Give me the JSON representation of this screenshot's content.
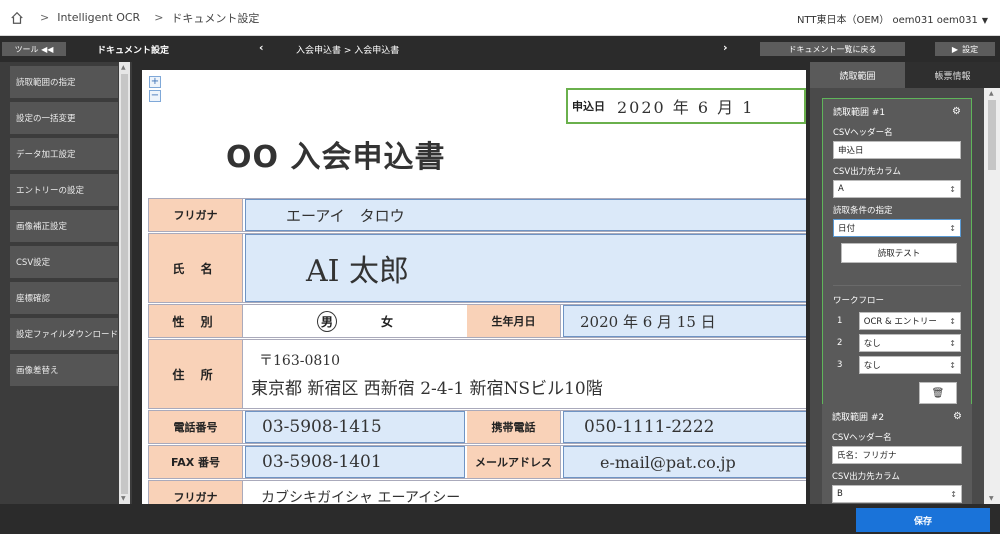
{
  "header": {
    "crumbs": [
      "Intelligent OCR",
      "ドキュメント設定"
    ],
    "separator": ">",
    "user": "NTT東日本（OEM） oem031 oem031"
  },
  "toolbar": {
    "tool_label": "ツール ◀◀",
    "doc_settings_title": "ドキュメント設定",
    "prev": "‹",
    "path": "入会申込書 > 入会申込書",
    "next": "›",
    "back_to_list": "ドキュメント一覧に戻る",
    "settings": "設定"
  },
  "sidebar": {
    "items": [
      {
        "label": "読取範囲の指定"
      },
      {
        "label": "設定の一括変更"
      },
      {
        "label": "データ加工設定"
      },
      {
        "label": "エントリーの設定"
      },
      {
        "label": "画像補正設定"
      },
      {
        "label": "CSV設定"
      },
      {
        "label": "座標確認"
      },
      {
        "label": "設定ファイルダウンロード"
      },
      {
        "label": "画像差替え"
      }
    ]
  },
  "document": {
    "apply_date_label": "申込日",
    "apply_date_value": "2020 年 6 月 1",
    "title": "OO 入会申込書",
    "rows": {
      "furigana_label": "フリガナ",
      "furigana_value": "エーアイ　タロウ",
      "name_label": "氏 名",
      "name_value": "AI 太郎",
      "gender_label": "性 別",
      "gender_male": "男",
      "gender_female": "女",
      "birth_label": "生年月日",
      "birth_value": "2020 年 6 月 15 日",
      "address_label": "住 所",
      "address_zip": "〒163-0810",
      "address_value": "東京都 新宿区 西新宿 2-4-1 新宿NSビル10階",
      "tel_label": "電話番号",
      "tel_value": "03-5908-1415",
      "mobile_label": "携帯電話",
      "mobile_value": "050-1111-2222",
      "fax_label": "FAX 番号",
      "fax_value": "03-5908-1401",
      "mail_label": "メールアドレス",
      "mail_value": "e-mail@pat.co.jp",
      "furigana2_label": "フリガナ",
      "furigana2_value": "カブシキガイシャ エーアイシー"
    }
  },
  "right_panel": {
    "tabs": [
      "読取範囲",
      "帳票情報"
    ],
    "areas": [
      {
        "title": "読取範囲 #1",
        "csv_header_label": "CSVヘッダー名",
        "csv_header_value": "申込日",
        "csv_column_label": "CSV出力先カラム",
        "csv_column_value": "A",
        "condition_label": "読取条件の指定",
        "condition_value": "日付",
        "test_button": "読取テスト",
        "workflow_label": "ワークフロー",
        "workflow": [
          {
            "num": "1",
            "value": "OCR & エントリー"
          },
          {
            "num": "2",
            "value": "なし"
          },
          {
            "num": "3",
            "value": "なし"
          }
        ]
      },
      {
        "title": "読取範囲 #2",
        "csv_header_label": "CSVヘッダー名",
        "csv_header_value": "氏名：フリガナ",
        "csv_column_label": "CSV出力先カラム",
        "csv_column_value": "B"
      }
    ]
  },
  "footer": {
    "save": "保存"
  }
}
